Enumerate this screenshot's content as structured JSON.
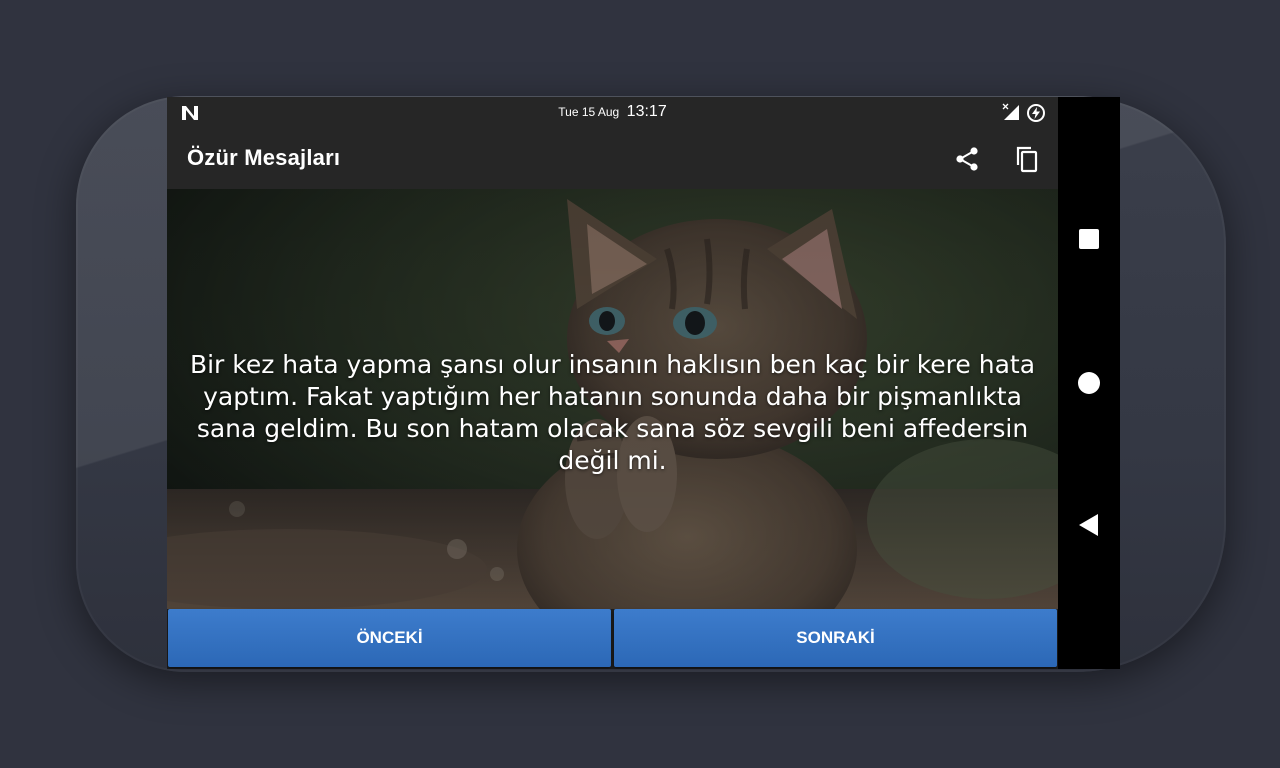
{
  "status_bar": {
    "date": "Tue 15 Aug",
    "time": "13:17",
    "notification_icon": "n-logo-icon",
    "signal_icon": "signal-off-icon",
    "battery_icon": "battery-charging-icon"
  },
  "app_bar": {
    "title": "Özür Mesajları",
    "actions": [
      "share-icon",
      "copy-icon"
    ]
  },
  "message": {
    "text": "Bir kez hata yapma şansı olur insanın haklısın ben kaç bir kere hata yaptım. Fakat yaptığım her hatanın sonunda daha bir pişmanlıkta sana geldim. Bu son hatam olacak sana söz sevgili beni affedersin değil mi."
  },
  "buttons": {
    "previous_label": "ÖNCEKİ",
    "next_label": "SONRAKİ"
  },
  "nav_bar": {
    "items": [
      "recents-icon",
      "home-icon",
      "back-icon"
    ]
  },
  "colors": {
    "button_blue": "#3572c0",
    "bar_dark": "#262626",
    "device_body": "#373a46",
    "background": "#30333f"
  }
}
